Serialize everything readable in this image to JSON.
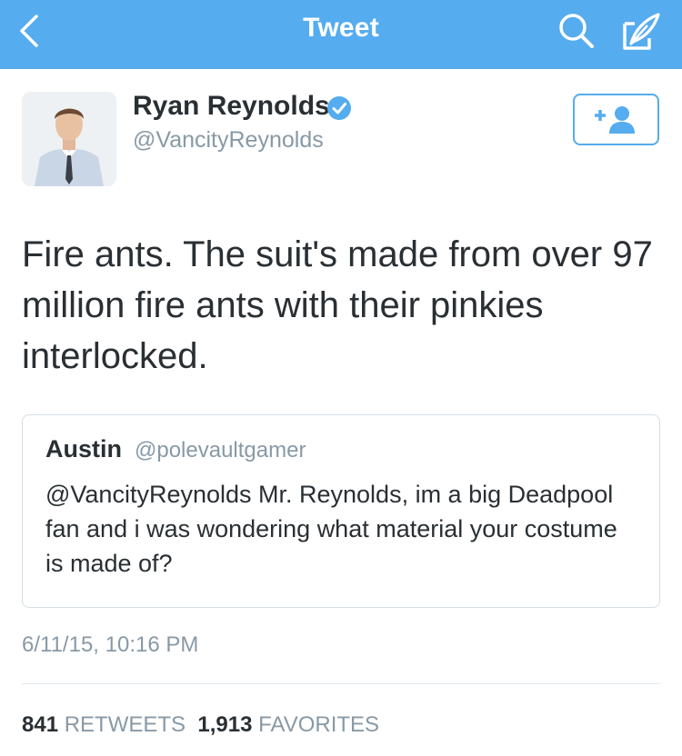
{
  "nav": {
    "title": "Tweet"
  },
  "author": {
    "name": "Ryan Reynolds",
    "handle": "@VancityReynolds",
    "verified": true
  },
  "tweet": {
    "text": "Fire ants. The suit's made from over 97 million fire ants with their pinkies interlocked."
  },
  "quoted": {
    "name": "Austin",
    "handle": "@polevaultgamer",
    "text": "@VancityReynolds Mr. Reynolds, im a big Deadpool fan and i was wondering what material your costume is made of?"
  },
  "meta": {
    "timestamp": "6/11/15, 10:16 PM"
  },
  "stats": {
    "retweets_count": "841",
    "retweets_label": "RETWEETS",
    "favorites_count": "1,913",
    "favorites_label": "FAVORITES"
  },
  "colors": {
    "navbar": "#55acee",
    "accent": "#55acee",
    "text": "#292f33",
    "muted": "#8899a6"
  }
}
